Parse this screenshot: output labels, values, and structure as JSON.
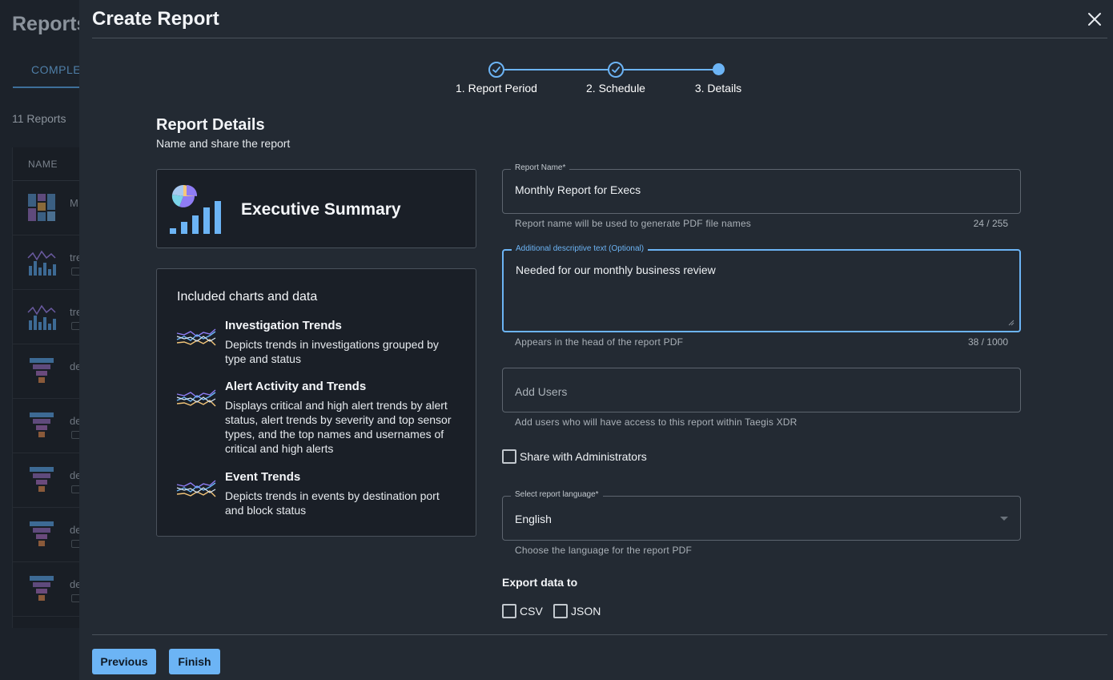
{
  "background": {
    "title": "Reports",
    "tab": "COMPLETED",
    "count": "11 Reports",
    "column_name": "NAME",
    "rows": [
      {
        "text": "M",
        "icon": "executive-thumb-icon"
      },
      {
        "text": "tre",
        "icon": "trend-chart-icon"
      },
      {
        "text": "tre",
        "icon": "trend-chart-icon"
      },
      {
        "text": "de",
        "icon": "funnel-icon"
      },
      {
        "text": "de",
        "icon": "funnel-icon"
      },
      {
        "text": "de",
        "icon": "funnel-icon"
      },
      {
        "text": "de",
        "icon": "funnel-icon"
      },
      {
        "text": "de",
        "icon": "funnel-icon"
      }
    ]
  },
  "modal": {
    "title": "Create Report",
    "close_icon": "close-icon",
    "steps": [
      {
        "label": "1. Report Period",
        "state": "done"
      },
      {
        "label": "2. Schedule",
        "state": "done"
      },
      {
        "label": "3. Details",
        "state": "current"
      }
    ],
    "section_title": "Report Details",
    "section_subtitle": "Name and share the report",
    "template": {
      "name": "Executive Summary",
      "icon": "pie-bar-chart-icon"
    },
    "included": {
      "title": "Included charts and data",
      "items": [
        {
          "title": "Investigation Trends",
          "desc": "Depicts trends in investigations grouped by type and status",
          "icon": "line-trend-icon"
        },
        {
          "title": "Alert Activity and Trends",
          "desc": "Displays critical and high alert trends by alert status, alert trends by severity and top sensor types, and the top names and usernames of critical and high alerts",
          "icon": "line-trend-icon"
        },
        {
          "title": "Event Trends",
          "desc": "Depicts trends in events by destination port and block status",
          "icon": "line-trend-icon"
        }
      ]
    },
    "form": {
      "report_name": {
        "label": "Report Name*",
        "value": "Monthly Report for Execs",
        "helper": "Report name will be used to generate PDF file names",
        "counter": "24 / 255"
      },
      "description": {
        "label": "Additional descriptive text (Optional)",
        "value": "Needed for our monthly business review",
        "helper": "Appears in the head of the report PDF",
        "counter": "38 / 1000"
      },
      "users": {
        "placeholder": "Add Users",
        "helper": "Add users who will have access to this report within Taegis XDR"
      },
      "share_admins": {
        "label": "Share with Administrators",
        "checked": false
      },
      "language": {
        "label": "Select report language*",
        "value": "English",
        "helper": "Choose the language for the report PDF"
      },
      "export": {
        "title": "Export data to",
        "options": [
          {
            "label": "CSV",
            "checked": false
          },
          {
            "label": "JSON",
            "checked": false
          }
        ]
      }
    },
    "buttons": {
      "previous": "Previous",
      "finish": "Finish"
    }
  },
  "colors": {
    "accent": "#6cb4f5",
    "modal_bg": "#232a33",
    "card_bg": "#1a1f27"
  }
}
